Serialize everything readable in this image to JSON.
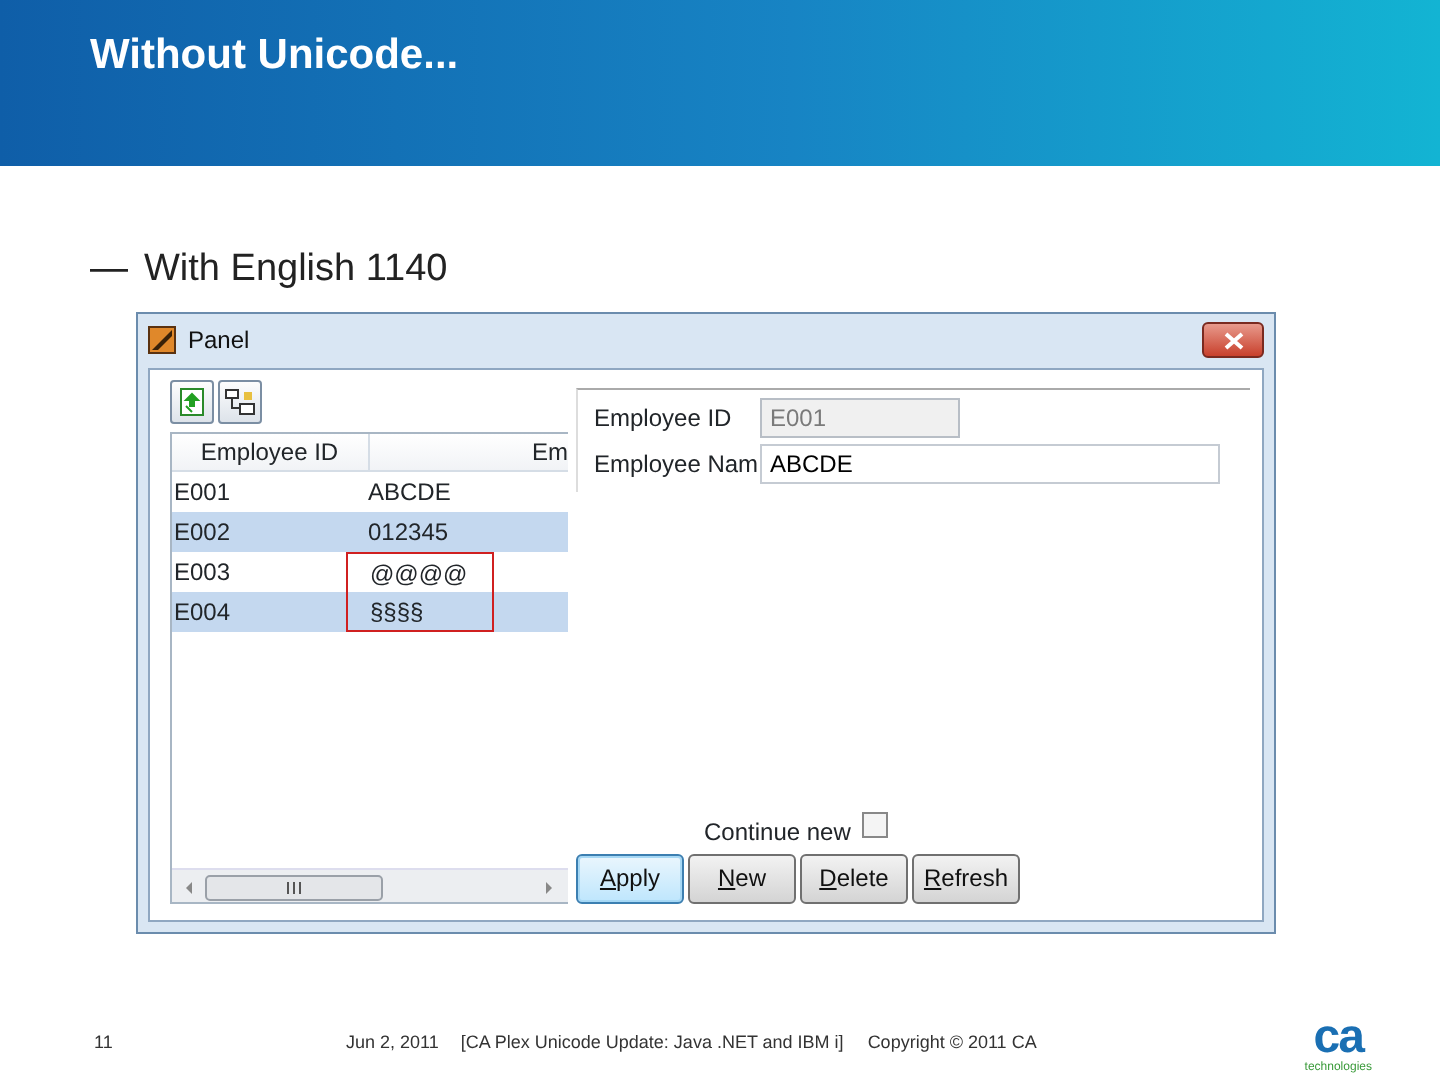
{
  "slide": {
    "title": "Without Unicode...",
    "bullet": "With English 1140",
    "bullet_dash": "—"
  },
  "window": {
    "title": "Panel"
  },
  "table": {
    "columns": [
      "Employee ID",
      "Em"
    ],
    "rows": [
      {
        "id": "E001",
        "name": "ABCDE",
        "shaded": false,
        "name_outlined": false
      },
      {
        "id": "E002",
        "name": "012345",
        "shaded": true,
        "name_outlined": false
      },
      {
        "id": "E003",
        "name": "@@@@",
        "shaded": false,
        "name_outlined": true
      },
      {
        "id": "E004",
        "name": "§§§§",
        "shaded": true,
        "name_outlined": true
      }
    ]
  },
  "form": {
    "fields": [
      {
        "label": "Employee ID",
        "value": "E001",
        "disabled": true
      },
      {
        "label": "Employee Nam",
        "value": "ABCDE",
        "disabled": false
      }
    ],
    "continue_new": {
      "label": "Continue new",
      "checked": false
    },
    "buttons": [
      {
        "label": "Apply",
        "mnemonic": true,
        "focused": true
      },
      {
        "label": "New",
        "mnemonic": true,
        "focused": false
      },
      {
        "label": "Delete",
        "mnemonic": true,
        "focused": false
      },
      {
        "label": "Refresh",
        "mnemonic": true,
        "focused": false
      }
    ]
  },
  "footer": {
    "page": "11",
    "date": "Jun 2, 2011",
    "topic": "[CA Plex Unicode Update: Java .NET and IBM i]",
    "copyright": "Copyright © 2011 CA",
    "logo_mark": "ca",
    "logo_sub": "technologies"
  }
}
